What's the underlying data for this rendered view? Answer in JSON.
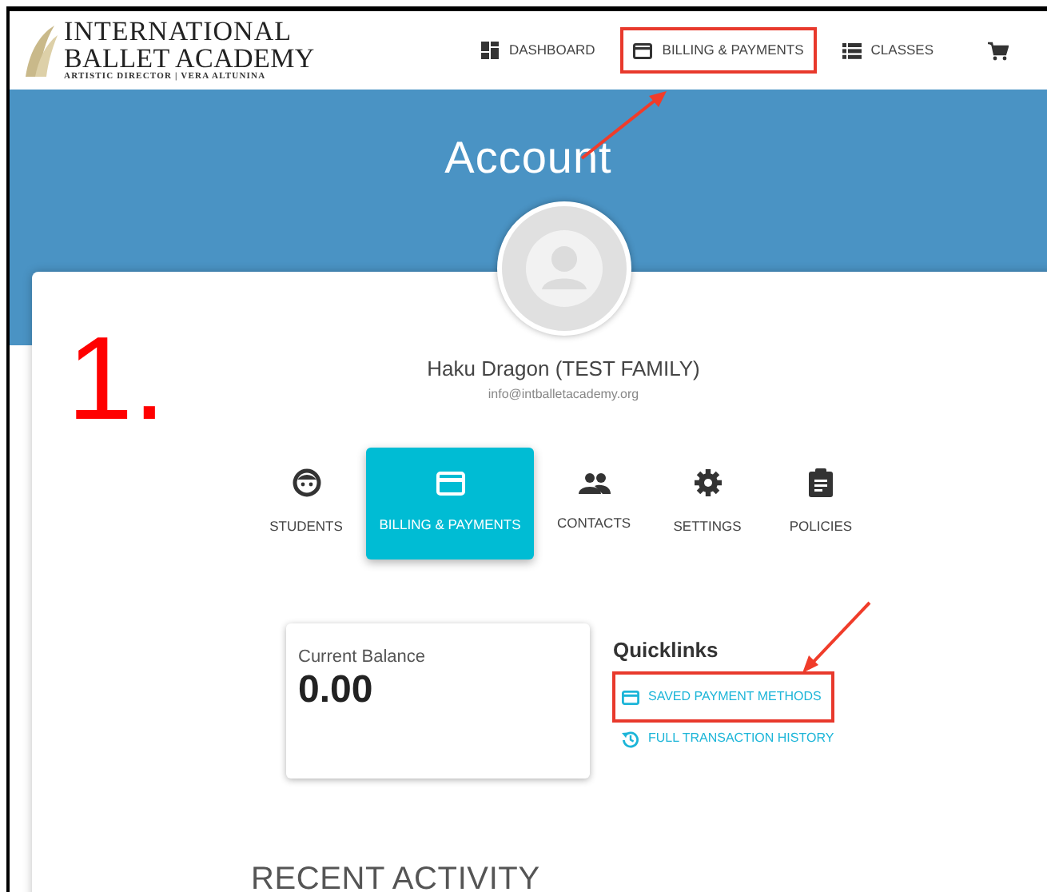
{
  "logo": {
    "line_1": "INTERNATIONAL",
    "line_2": "BALLET ACADEMY",
    "tagline": "ARTISTIC DIRECTOR | VERA ALTUNINA"
  },
  "nav": [
    {
      "kind": "dashboard",
      "label": "DASHBOARD",
      "highlighted": false
    },
    {
      "kind": "billing",
      "label": "BILLING & PAYMENTS",
      "highlighted": true
    },
    {
      "kind": "classes",
      "label": "CLASSES",
      "highlighted": false
    },
    {
      "kind": "cart",
      "highlighted": false
    }
  ],
  "page_title": "Account",
  "step_label": "1.",
  "profile": {
    "name": "Haku Dragon (TEST FAMILY)",
    "email": "info@intballetacademy.org"
  },
  "tabs": [
    {
      "kind": "students",
      "label": "STUDENTS",
      "selected": false
    },
    {
      "kind": "billing",
      "label": "BILLING & PAYMENTS",
      "selected": true
    },
    {
      "kind": "contacts",
      "label": "CONTACTS",
      "selected": false
    },
    {
      "kind": "settings",
      "label": "SETTINGS",
      "selected": false
    },
    {
      "kind": "policies",
      "label": "POLICIES",
      "selected": false
    }
  ],
  "balance": {
    "label": "Current Balance",
    "value": "0.00"
  },
  "quicklinks": {
    "title": "Quicklinks",
    "links": [
      {
        "kind": "card",
        "label": "SAVED PAYMENT METHODS",
        "highlighted": true
      },
      {
        "kind": "history",
        "label": "FULL TRANSACTION HISTORY",
        "highlighted": false
      }
    ]
  },
  "recent_activity": {
    "title": "RECENT ACTIVITY"
  }
}
